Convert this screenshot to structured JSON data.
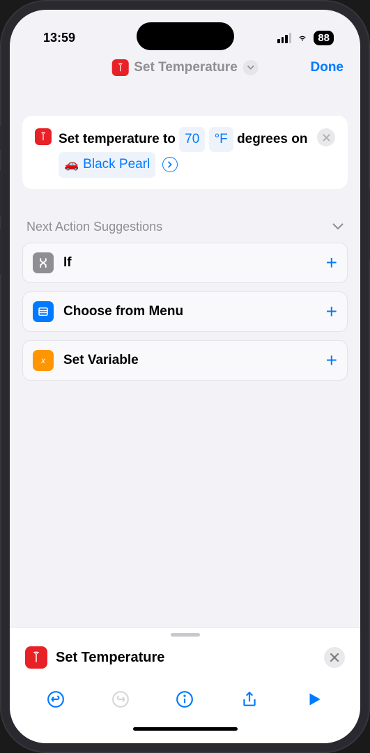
{
  "status": {
    "time": "13:59",
    "battery": "88"
  },
  "nav": {
    "title": "Set Temperature",
    "done": "Done"
  },
  "action": {
    "prefix": "Set temperature to",
    "value": "70",
    "unit": "°F",
    "mid": "degrees on",
    "vehicle": "Black Pearl"
  },
  "suggestions": {
    "header": "Next Action Suggestions",
    "items": [
      {
        "label": "If",
        "iconColor": "gray"
      },
      {
        "label": "Choose from Menu",
        "iconColor": "blue"
      },
      {
        "label": "Set Variable",
        "iconColor": "orange"
      }
    ]
  },
  "sheet": {
    "title": "Set Temperature"
  }
}
